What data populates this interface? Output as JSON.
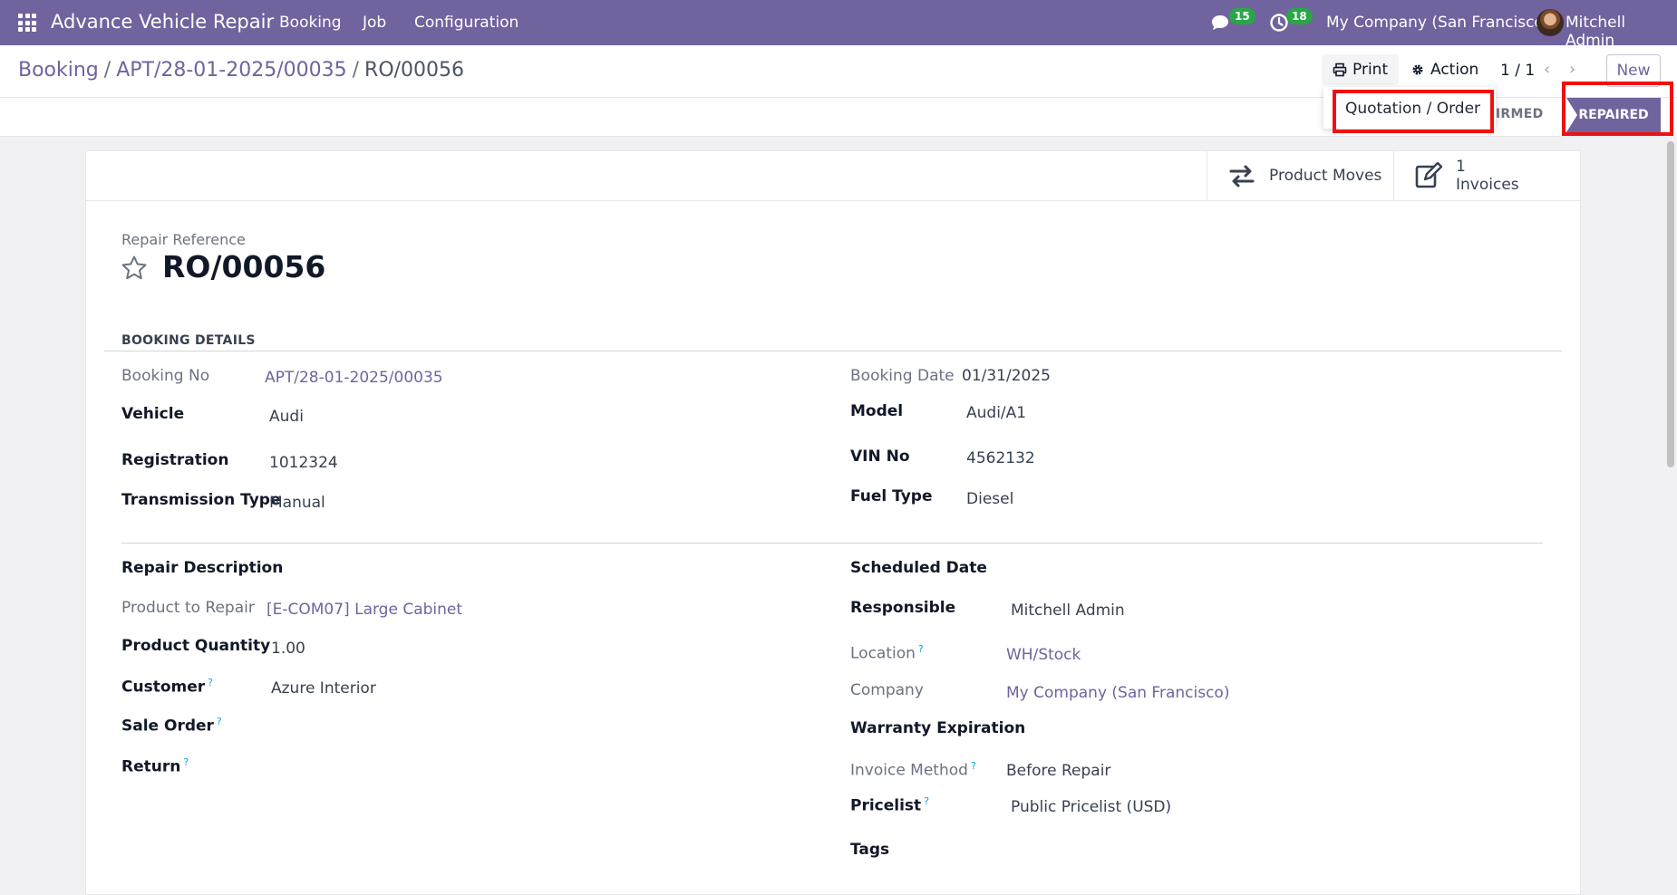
{
  "navbar": {
    "app_name": "Advance Vehicle Repair",
    "menu": [
      "Booking",
      "Job",
      "Configuration"
    ],
    "messages_count": "15",
    "activities_count": "18",
    "company": "My Company (San Francisco)",
    "user": "Mitchell Admin"
  },
  "breadcrumb": {
    "root": "Booking",
    "parent": "APT/28-01-2025/00035",
    "current": "RO/00056"
  },
  "toolbar": {
    "print_label": "Print",
    "action_label": "Action",
    "pager": "1 / 1",
    "new_label": "New"
  },
  "print_menu": {
    "items": [
      "Quotation / Order"
    ]
  },
  "status": {
    "confirmed": "NFIRMED",
    "repaired": "REPAIRED"
  },
  "smart_buttons": {
    "product_moves": "Product Moves",
    "invoices_count": "1",
    "invoices_label": "Invoices"
  },
  "form": {
    "ref_label": "Repair Reference",
    "ref": "RO/00056",
    "booking_section": "BOOKING DETAILS",
    "booking_no_label": "Booking No",
    "booking_no": "APT/28-01-2025/00035",
    "vehicle_label": "Vehicle",
    "vehicle": "Audi",
    "registration_label": "Registration",
    "registration": "1012324",
    "transmission_label": "Transmission Type",
    "transmission": "Manual",
    "booking_date_label": "Booking Date",
    "booking_date": "01/31/2025",
    "model_label": "Model",
    "model": "Audi/A1",
    "vin_label": "VIN No",
    "vin": "4562132",
    "fuel_label": "Fuel Type",
    "fuel": "Diesel",
    "repair_desc_label": "Repair Description",
    "product_label": "Product to Repair",
    "product": "[E-COM07] Large Cabinet",
    "qty_label": "Product Quantity",
    "qty": "1.00",
    "customer_label": "Customer",
    "customer": "Azure Interior",
    "sale_order_label": "Sale Order",
    "return_label": "Return",
    "scheduled_label": "Scheduled Date",
    "responsible_label": "Responsible",
    "responsible": "Mitchell Admin",
    "location_label": "Location",
    "location": "WH/Stock",
    "company_label": "Company",
    "company": "My Company (San Francisco)",
    "warranty_label": "Warranty Expiration",
    "invoice_method_label": "Invoice Method",
    "invoice_method": "Before Repair",
    "pricelist_label": "Pricelist",
    "pricelist": "Public Pricelist (USD)",
    "tags_label": "Tags",
    "help_mark": "?"
  }
}
